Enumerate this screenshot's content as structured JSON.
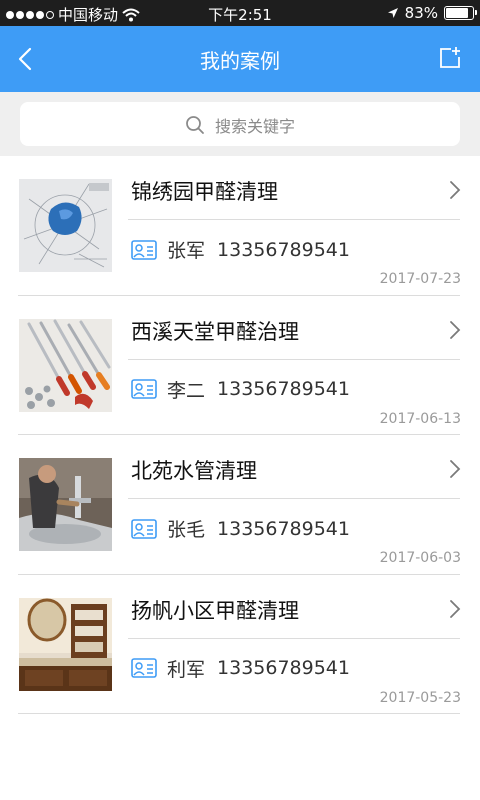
{
  "status_bar": {
    "carrier": "中国移动",
    "time": "下午2:51",
    "battery": "83%",
    "battery_level": 0.83,
    "signal_bars": 4,
    "signal_icon": "signal-dots-icon",
    "wifi_icon": "wifi-icon",
    "location_icon": "location-arrow-icon"
  },
  "nav": {
    "title": "我的案例",
    "back_icon": "chevron-left-icon",
    "add_icon": "add-case-icon",
    "color": "#3e9cf6"
  },
  "search": {
    "placeholder": "搜索关键字",
    "icon": "search-icon"
  },
  "cases": [
    {
      "title": "锦绣园甲醛清理",
      "name": "张军",
      "phone": "13356789541",
      "date": "2017-07-23",
      "thumb": "design-sketch-photo"
    },
    {
      "title": "西溪天堂甲醛治理",
      "name": "李二",
      "phone": "13356789541",
      "date": "2017-06-13",
      "thumb": "tools-photo"
    },
    {
      "title": "北苑水管清理",
      "name": "张毛",
      "phone": "13356789541",
      "date": "2017-06-03",
      "thumb": "plumber-photo"
    },
    {
      "title": "扬帆小区甲醛清理",
      "name": "利军",
      "phone": "13356789541",
      "date": "2017-05-23",
      "thumb": "bathroom-photo"
    }
  ]
}
